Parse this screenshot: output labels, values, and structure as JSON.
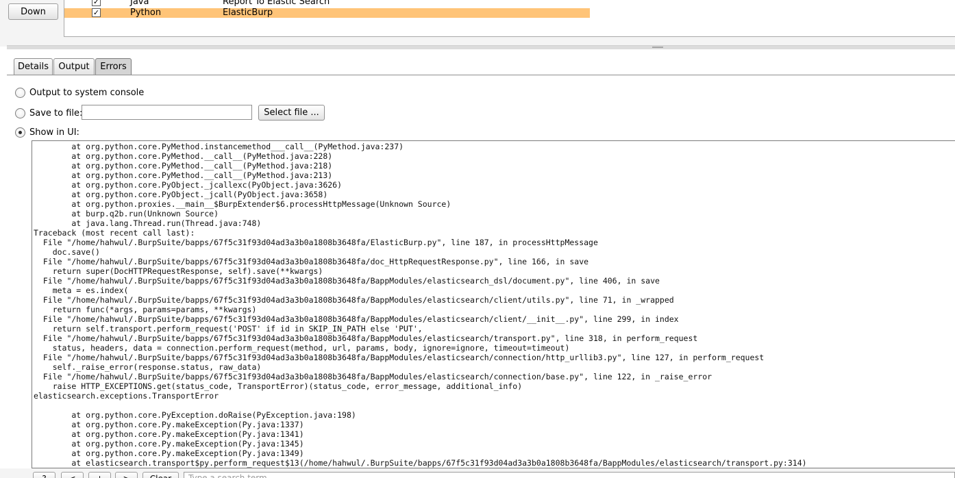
{
  "toolbar": {
    "down_label": "Down"
  },
  "extensions": [
    {
      "type": "Java",
      "name": "Report To Elastic Search",
      "checked": "✓"
    },
    {
      "type": "Python",
      "name": "ElasticBurp",
      "checked": "✓"
    }
  ],
  "tabs": [
    {
      "label": "Details"
    },
    {
      "label": "Output"
    },
    {
      "label": "Errors"
    }
  ],
  "errors_panel": {
    "option_console": "Output to system console",
    "option_file": "Save to file:",
    "file_value": "",
    "select_file_label": "Select file ...",
    "option_ui": "Show in UI:",
    "log_text": "        at org.python.core.PyMethod.instancemethod___call__(PyMethod.java:237)\n        at org.python.core.PyMethod.__call__(PyMethod.java:228)\n        at org.python.core.PyMethod.__call__(PyMethod.java:218)\n        at org.python.core.PyMethod.__call__(PyMethod.java:213)\n        at org.python.core.PyObject._jcallexc(PyObject.java:3626)\n        at org.python.core.PyObject._jcall(PyObject.java:3658)\n        at org.python.proxies.__main__$BurpExtender$6.processHttpMessage(Unknown Source)\n        at burp.q2b.run(Unknown Source)\n        at java.lang.Thread.run(Thread.java:748)\nTraceback (most recent call last):\n  File \"/home/hahwul/.BurpSuite/bapps/67f5c31f93d04ad3a3b0a1808b3648fa/ElasticBurp.py\", line 187, in processHttpMessage\n    doc.save()\n  File \"/home/hahwul/.BurpSuite/bapps/67f5c31f93d04ad3a3b0a1808b3648fa/doc_HttpRequestResponse.py\", line 166, in save\n    return super(DocHTTPRequestResponse, self).save(**kwargs)\n  File \"/home/hahwul/.BurpSuite/bapps/67f5c31f93d04ad3a3b0a1808b3648fa/BappModules/elasticsearch_dsl/document.py\", line 406, in save\n    meta = es.index(\n  File \"/home/hahwul/.BurpSuite/bapps/67f5c31f93d04ad3a3b0a1808b3648fa/BappModules/elasticsearch/client/utils.py\", line 71, in _wrapped\n    return func(*args, params=params, **kwargs)\n  File \"/home/hahwul/.BurpSuite/bapps/67f5c31f93d04ad3a3b0a1808b3648fa/BappModules/elasticsearch/client/__init__.py\", line 299, in index\n    return self.transport.perform_request('POST' if id in SKIP_IN_PATH else 'PUT',\n  File \"/home/hahwul/.BurpSuite/bapps/67f5c31f93d04ad3a3b0a1808b3648fa/BappModules/elasticsearch/transport.py\", line 318, in perform_request\n    status, headers, data = connection.perform_request(method, url, params, body, ignore=ignore, timeout=timeout)\n  File \"/home/hahwul/.BurpSuite/bapps/67f5c31f93d04ad3a3b0a1808b3648fa/BappModules/elasticsearch/connection/http_urllib3.py\", line 127, in perform_request\n    self._raise_error(response.status, raw_data)\n  File \"/home/hahwul/.BurpSuite/bapps/67f5c31f93d04ad3a3b0a1808b3648fa/BappModules/elasticsearch/connection/base.py\", line 122, in _raise_error\n    raise HTTP_EXCEPTIONS.get(status_code, TransportError)(status_code, error_message, additional_info)\nelasticsearch.exceptions.TransportError\n\n        at org.python.core.PyException.doRaise(PyException.java:198)\n        at org.python.core.Py.makeException(Py.java:1337)\n        at org.python.core.Py.makeException(Py.java:1341)\n        at org.python.core.Py.makeException(Py.java:1345)\n        at org.python.core.Py.makeException(Py.java:1349)\n        at elasticsearch.transport$py.perform_request$13(/home/hahwul/.BurpSuite/bapps/67f5c31f93d04ad3a3b0a1808b3648fa/BappModules/elasticsearch/transport.py:314)"
  },
  "search_bar": {
    "help_label": "?",
    "prev_label": "<",
    "next_label": "+",
    "forward_label": ">",
    "clear_label": "Clear",
    "placeholder": "Type a search term"
  },
  "colors": {
    "selected_row": "#ffc478",
    "panel_bg": "#f4f4f4"
  }
}
